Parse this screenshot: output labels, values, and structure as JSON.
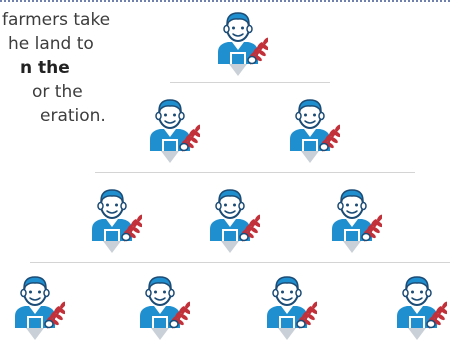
{
  "text_lines": [
    "farmers take",
    "he land to",
    "n the",
    "or the",
    "eration."
  ],
  "colors": {
    "farmer_blue": "#1f8fcf",
    "farmer_dark": "#1c4c75",
    "skin": "#ffffff",
    "wheat": "#c2313a",
    "arrow": "#c9d0d8",
    "tier_line": "#d4d4d4",
    "border_dots": "#6e7fb0",
    "text": "#3d3d3d"
  },
  "icons": {
    "farmer": "farmer-with-wheat-icon",
    "arrow": "down-triangle-icon"
  },
  "generations": [
    {
      "farmers": 1
    },
    {
      "farmers": 2
    },
    {
      "farmers": 3
    },
    {
      "farmers": 4
    }
  ]
}
